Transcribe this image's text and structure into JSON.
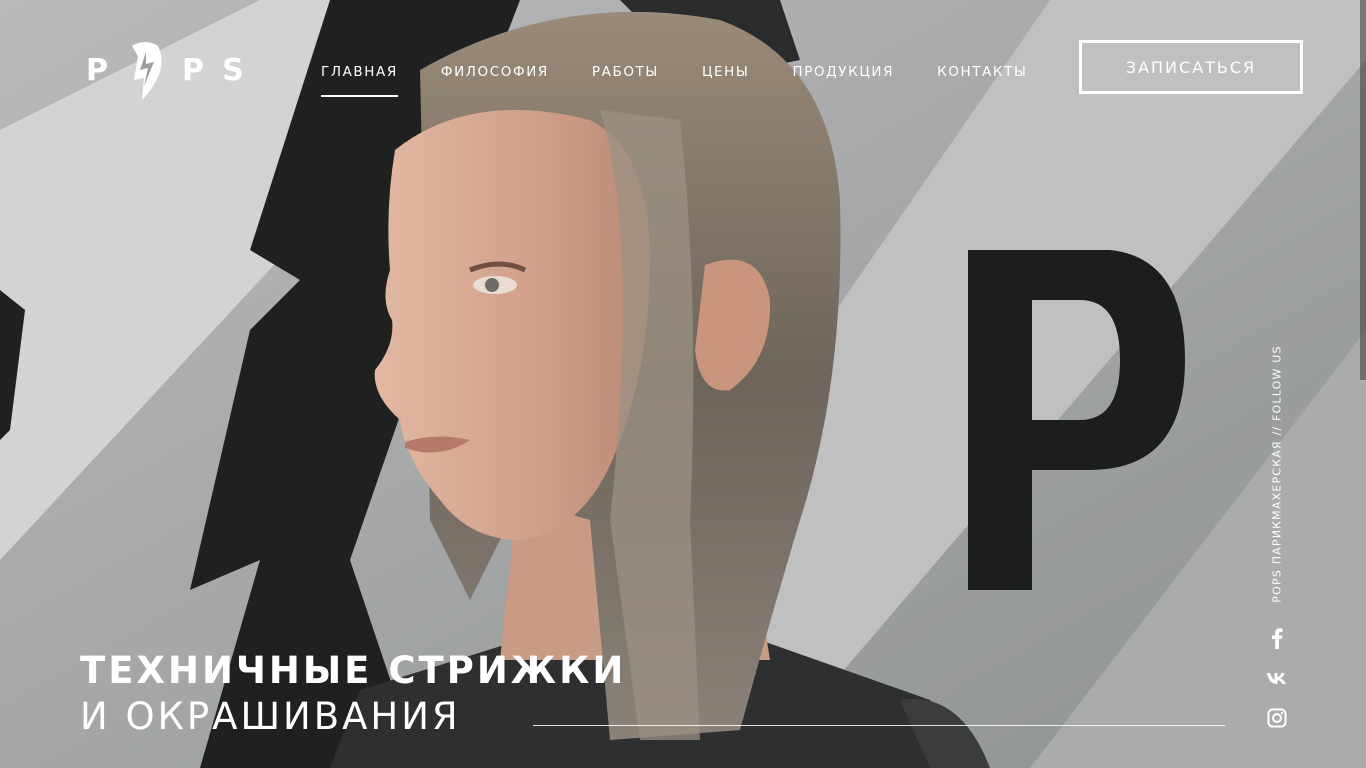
{
  "brand": {
    "logo_text": "POPS",
    "logo_letters": [
      "P",
      "P",
      "S"
    ]
  },
  "nav": {
    "items": [
      {
        "label": "ГЛАВНАЯ",
        "active": true
      },
      {
        "label": "ФИЛОСОФИЯ",
        "active": false
      },
      {
        "label": "РАБОТЫ",
        "active": false
      },
      {
        "label": "ЦЕНЫ",
        "active": false
      },
      {
        "label": "ПРОДУКЦИЯ",
        "active": false
      },
      {
        "label": "КОНТАКТЫ",
        "active": false
      }
    ]
  },
  "cta": {
    "label": "ЗАПИСАТЬСЯ"
  },
  "hero": {
    "title": "ТЕХНИЧНЫЕ СТРИЖКИ",
    "subtitle": "И ОКРАШИВАНИЯ",
    "background_letter": "P"
  },
  "follow": {
    "text": "POPS ПАРИКМАХЕРСКАЯ // FOLLOW US"
  },
  "social": [
    {
      "name": "facebook-icon",
      "glyph": "f"
    },
    {
      "name": "vk-icon",
      "glyph": "vk"
    },
    {
      "name": "instagram-icon",
      "glyph": ""
    }
  ],
  "colors": {
    "text": "#ffffff",
    "wall_light": "#c9c9c7",
    "wall_stripe": "#8e9193",
    "mural_dark": "#1d1f21"
  }
}
